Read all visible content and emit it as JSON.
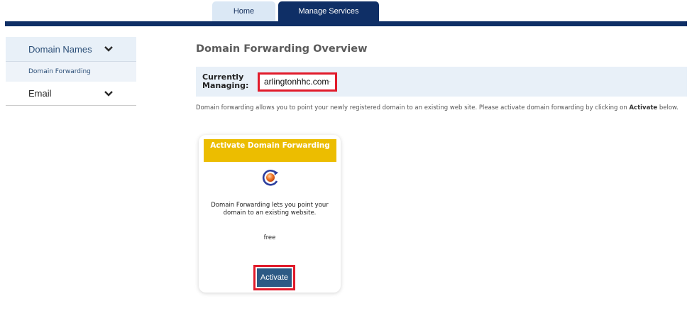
{
  "tabs": [
    {
      "label": "Home"
    },
    {
      "label": "Manage Services"
    }
  ],
  "sidebar": {
    "domain_names": {
      "label": "Domain Names",
      "icon": "chevron-down-icon"
    },
    "domain_forwarding": {
      "label": "Domain Forwarding"
    },
    "email": {
      "label": "Email",
      "icon": "chevron-down-icon"
    }
  },
  "main": {
    "title": "Domain Forwarding Overview",
    "managing_label": "Currently\nManaging:",
    "selected_domain": "arlingtonhhc.com",
    "intro_text": "Domain forwarding allows you to point your newly registered domain to an existing web site. Please activate domain forwarding by clicking on ",
    "intro_bold": "Activate",
    "intro_end": " below."
  },
  "card": {
    "header": "Activate Domain Forwarding",
    "icon": "refresh-orb-icon",
    "description": "Domain Forwarding lets you point your domain to an existing website.",
    "price": "free",
    "button": "Activate"
  },
  "colors": {
    "navy": "#0f2f66",
    "tab_light": "#dbe8f5",
    "highlight_red": "#e11b2b",
    "card_header": "#ecbd00",
    "button": "#2c5a85"
  }
}
